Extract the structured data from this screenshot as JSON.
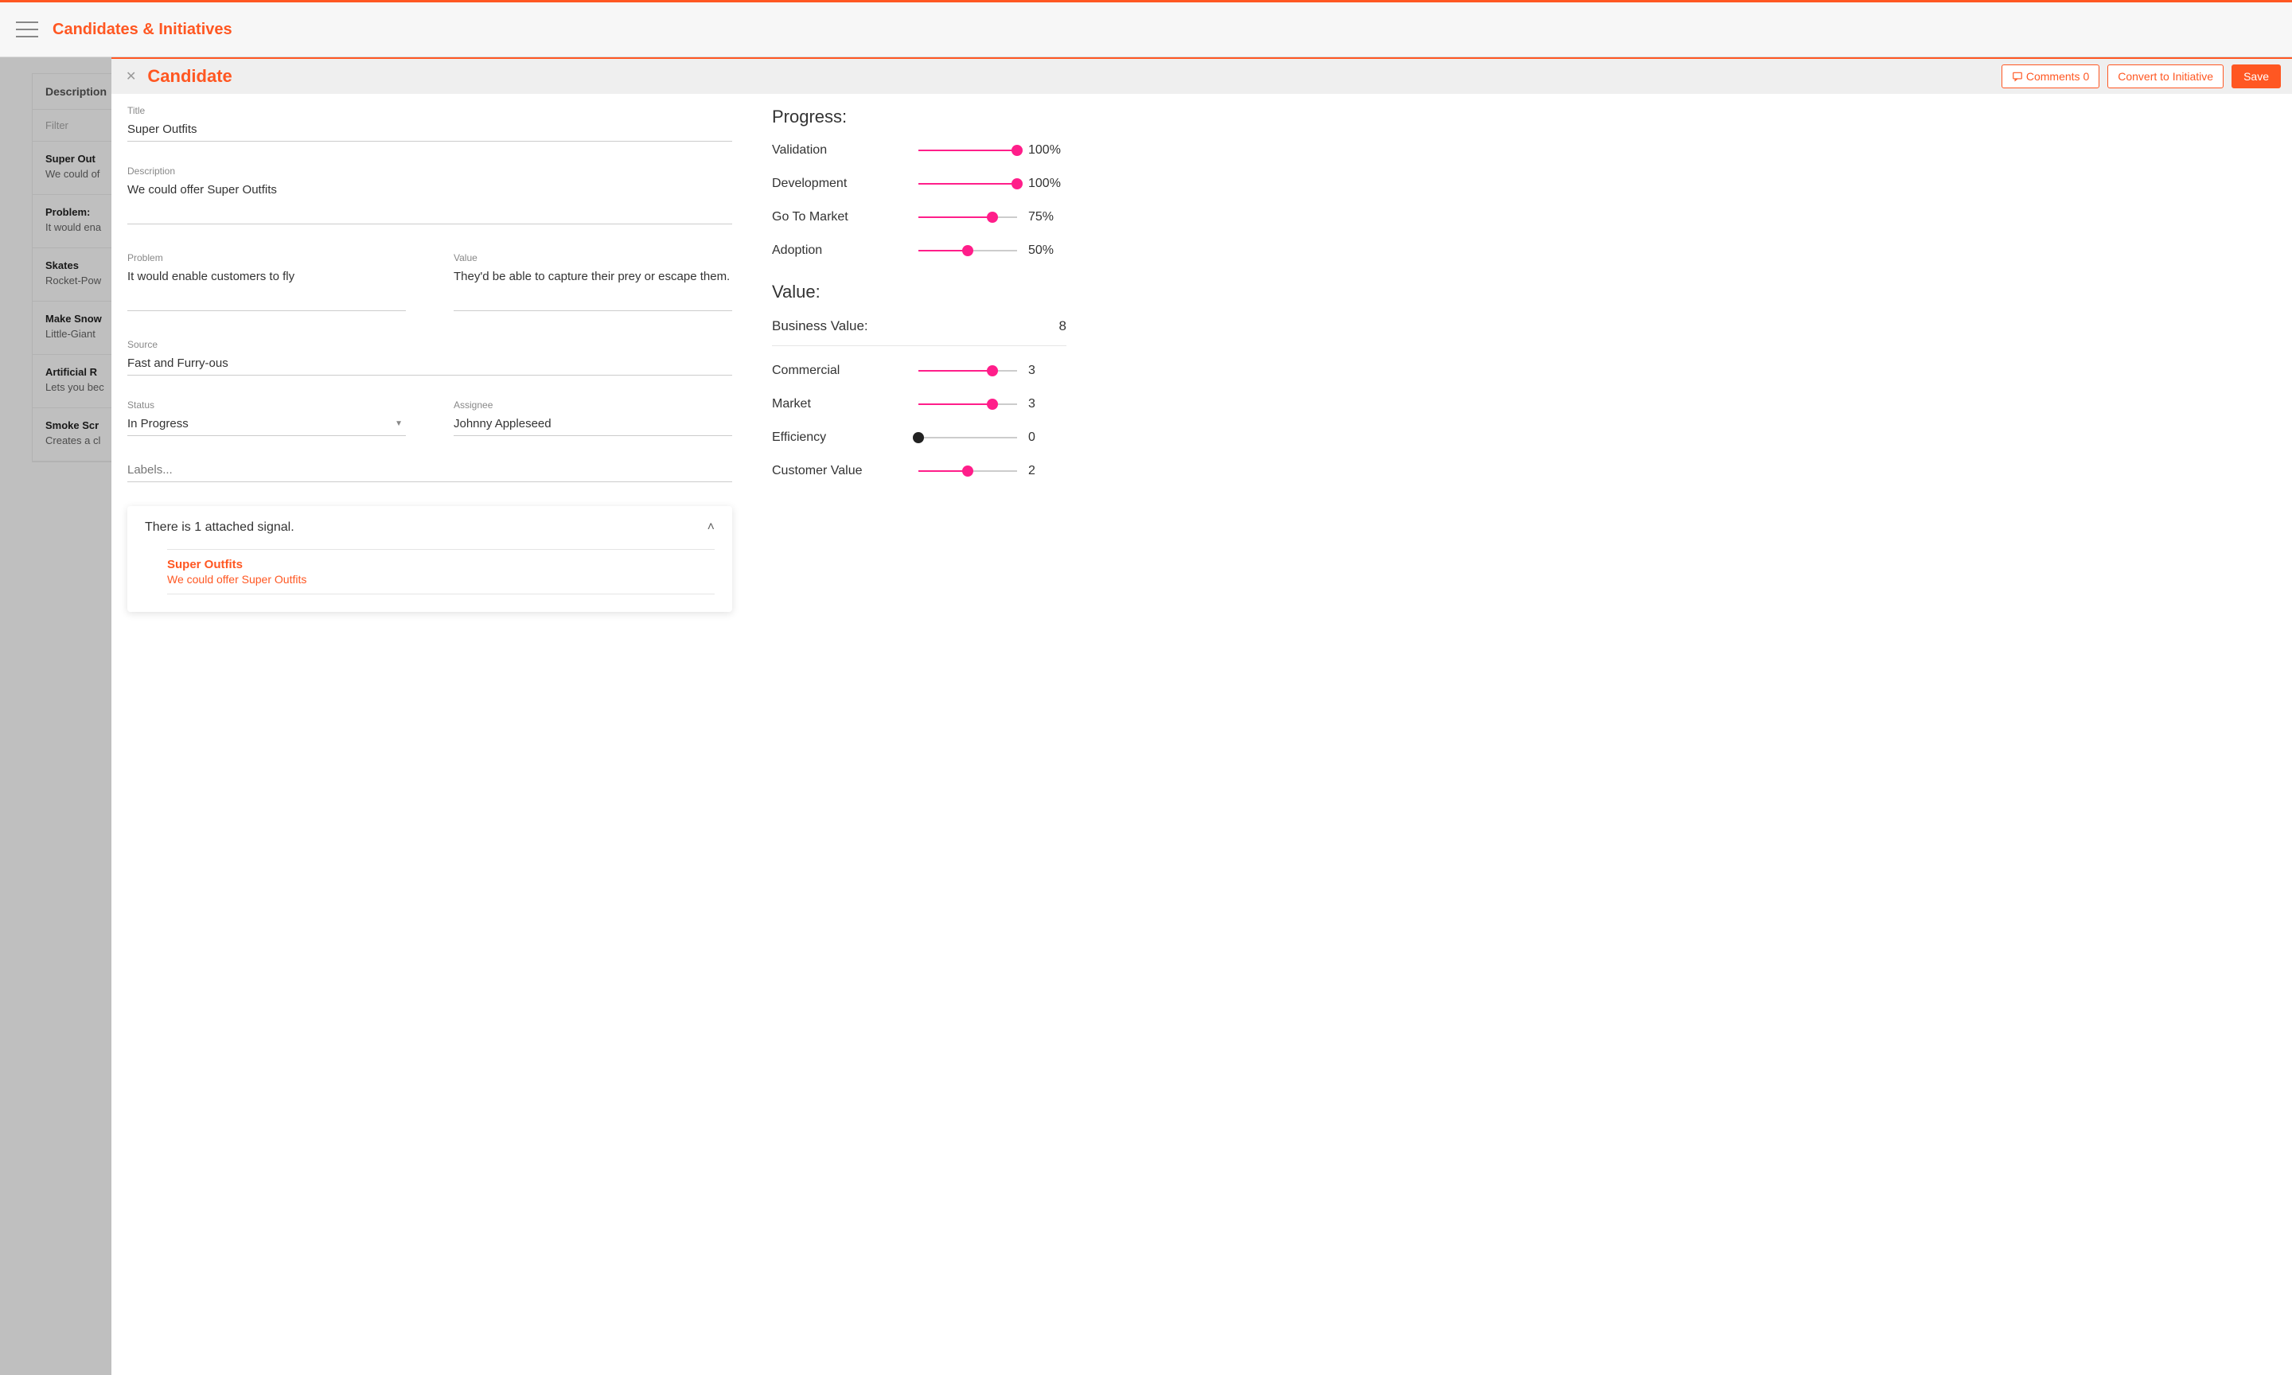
{
  "header": {
    "page_title": "Candidates & Initiatives"
  },
  "back_list": {
    "column_header": "Description",
    "filter_placeholder": "Filter",
    "items": [
      {
        "title": "Super Out",
        "desc": "We could of"
      },
      {
        "title": "Problem:",
        "desc": "It would ena"
      },
      {
        "title": "Skates",
        "desc": "Rocket-Pow"
      },
      {
        "title": "Make Snow",
        "desc": "Little-Giant"
      },
      {
        "title": "Artificial R",
        "desc": "Lets you bec"
      },
      {
        "title": "Smoke Scr",
        "desc": "Creates a cl"
      }
    ]
  },
  "panel": {
    "title": "Candidate",
    "comments_label": "Comments 0",
    "convert_label": "Convert to Initiative",
    "save_label": "Save"
  },
  "form": {
    "title_label": "Title",
    "title_value": "Super Outfits",
    "description_label": "Description",
    "description_value": "We could offer Super Outfits",
    "problem_label": "Problem",
    "problem_value": "It would enable customers to fly",
    "value_label": "Value",
    "value_value": "They'd be able to capture their prey or escape them.",
    "source_label": "Source",
    "source_value": "Fast and Furry-ous",
    "status_label": "Status",
    "status_value": "In Progress",
    "assignee_label": "Assignee",
    "assignee_value": "Johnny Appleseed",
    "labels_placeholder": "Labels..."
  },
  "signals": {
    "summary": "There is 1 attached signal.",
    "items": [
      {
        "title": "Super Outfits",
        "desc": "We could offer Super Outfits"
      }
    ]
  },
  "progress": {
    "heading": "Progress:",
    "items": [
      {
        "label": "Validation",
        "percent": 100,
        "display": "100%"
      },
      {
        "label": "Development",
        "percent": 100,
        "display": "100%"
      },
      {
        "label": "Go To Market",
        "percent": 75,
        "display": "75%"
      },
      {
        "label": "Adoption",
        "percent": 50,
        "display": "50%"
      }
    ]
  },
  "value": {
    "heading": "Value:",
    "business_label": "Business Value:",
    "business_value": "8",
    "items": [
      {
        "label": "Commercial",
        "val": 3,
        "max": 4,
        "display": "3"
      },
      {
        "label": "Market",
        "val": 3,
        "max": 4,
        "display": "3"
      },
      {
        "label": "Efficiency",
        "val": 0,
        "max": 4,
        "display": "0"
      },
      {
        "label": "Customer Value",
        "val": 2,
        "max": 4,
        "display": "2"
      }
    ]
  }
}
